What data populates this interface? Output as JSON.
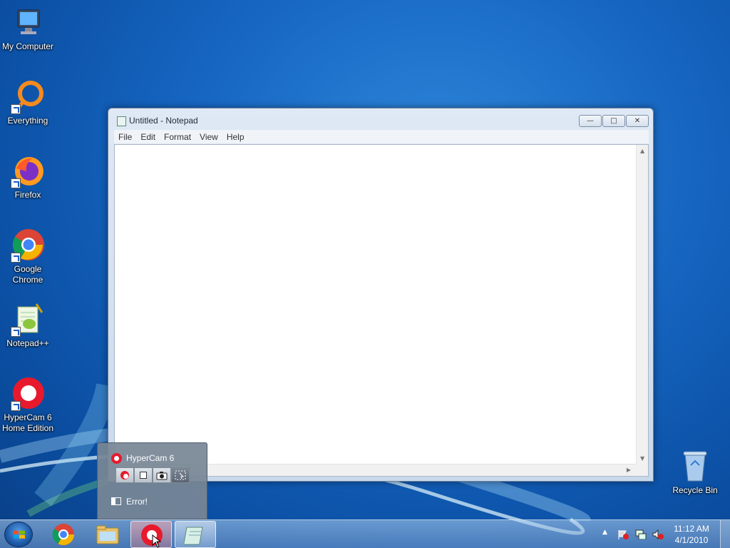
{
  "desktop": {
    "icons": [
      {
        "label": "My Computer",
        "icon": "computer-icon"
      },
      {
        "label": "Everything",
        "icon": "everything-icon"
      },
      {
        "label": "Firefox",
        "icon": "firefox-icon"
      },
      {
        "label_line1": "Google",
        "label_line2": "Chrome",
        "icon": "chrome-icon"
      },
      {
        "label": "Notepad++",
        "icon": "notepadpp-icon"
      },
      {
        "label_line1": "HyperCam 6",
        "label_line2": "Home Edition",
        "icon": "hypercam-icon"
      },
      {
        "label": "Recycle Bin",
        "icon": "recycle-bin-icon"
      }
    ]
  },
  "notepad": {
    "title": "Untitled - Notepad",
    "menu": [
      "File",
      "Edit",
      "Format",
      "View",
      "Help"
    ],
    "content": ""
  },
  "hypercam_popup": {
    "title": "HyperCam 6",
    "status": "Error!",
    "buttons": [
      "record-icon",
      "stop-icon",
      "camera-icon",
      "region-icon"
    ]
  },
  "taskbar": {
    "pinned": [
      "chrome-icon",
      "explorer-icon",
      "hypercam-icon",
      "notepad-icon"
    ],
    "clock_time": "11:12 AM",
    "clock_date": "4/1/2010"
  },
  "colors": {
    "desktop_blue": "#1666c2",
    "hypercam_red": "#e8192c"
  }
}
